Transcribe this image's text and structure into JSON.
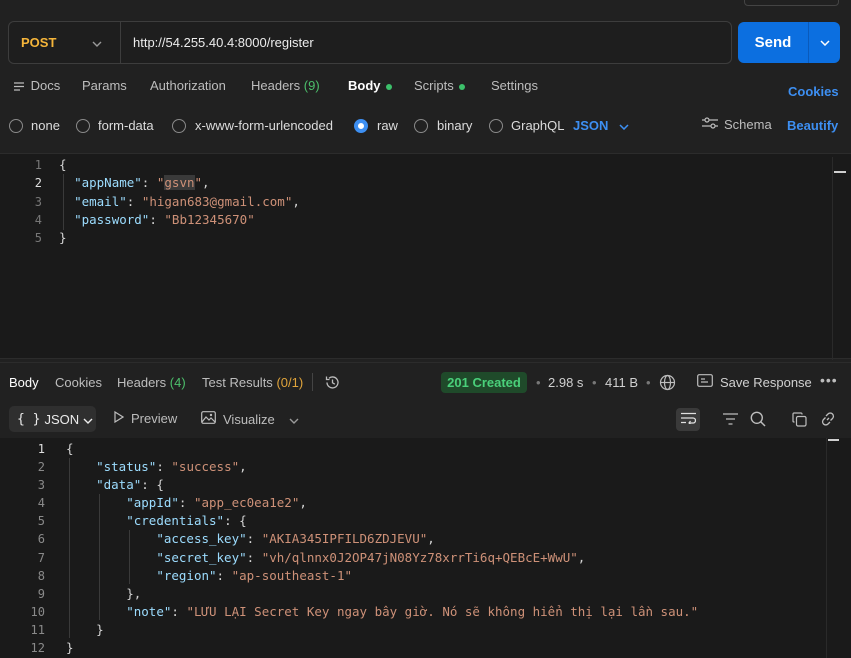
{
  "request": {
    "method": "POST",
    "url": "http://54.255.40.4:8000/register",
    "send_label": "Send"
  },
  "request_tabs": {
    "docs": "Docs",
    "params": "Params",
    "authorization": "Authorization",
    "headers": "Headers",
    "headers_count": "(9)",
    "body": "Body",
    "scripts": "Scripts",
    "settings": "Settings",
    "cookies": "Cookies"
  },
  "body_types": {
    "none": "none",
    "form_data": "form-data",
    "urlencoded": "x-www-form-urlencoded",
    "raw": "raw",
    "binary": "binary",
    "graphql": "GraphQL",
    "selected": "raw",
    "format": "JSON",
    "schema": "Schema",
    "beautify": "Beautify"
  },
  "request_body": {
    "line_numbers": [
      "1",
      "2",
      "3",
      "4",
      "5"
    ],
    "app_name": "gsvn",
    "email": "higan683@gmail.com",
    "password": "Bb12345670"
  },
  "response_tabs": {
    "body": "Body",
    "cookies": "Cookies",
    "headers": "Headers",
    "headers_count": "(4)",
    "test_results": "Test Results",
    "test_count": "(0/1)"
  },
  "response_meta": {
    "status": "201 Created",
    "time": "2.98 s",
    "size": "411 B",
    "save_response": "Save Response"
  },
  "response_toolbar": {
    "format": "JSON",
    "preview": "Preview",
    "visualize": "Visualize"
  },
  "response_body": {
    "line_numbers": [
      "1",
      "2",
      "3",
      "4",
      "5",
      "6",
      "7",
      "8",
      "9",
      "10",
      "11",
      "12"
    ],
    "status": "success",
    "app_id": "app_ec0ea1e2",
    "access_key": "AKIA345IPFILD6ZDJEVU",
    "secret_key": "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",
    "region": "ap-southeast-1",
    "note": "LƯU LẠI Secret Key ngay bây giờ. Nó sẽ không hiển thị lại lần sau."
  },
  "colors": {
    "accent": "#0c6fe0",
    "link": "#3d8ff2",
    "method": "#f5b53a",
    "success": "#4ad07a"
  }
}
